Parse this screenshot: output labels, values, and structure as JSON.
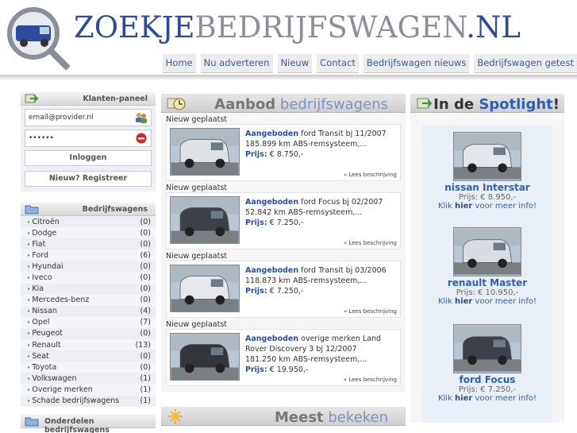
{
  "header": {
    "logo": {
      "part1": "ZOEKJE",
      "part2": "BEDRIJFSWAGEN",
      "part3": ".NL"
    },
    "nav": [
      "Home",
      "Nu adverteren",
      "Nieuw",
      "Contact",
      "Bedrijfswagen nieuws",
      "Bedrijfswagen getest"
    ]
  },
  "login": {
    "title": "Klanten-paneel",
    "email_value": "email@provider.nl",
    "password_value": "••••••",
    "login_button": "Inloggen",
    "register_button": "Nieuw? Registreer"
  },
  "brands": {
    "title": "Bedrijfswagens",
    "items": [
      {
        "name": "Citroën",
        "count": "(0)"
      },
      {
        "name": "Dodge",
        "count": "(0)"
      },
      {
        "name": "Fiat",
        "count": "(0)"
      },
      {
        "name": "Ford",
        "count": "(6)"
      },
      {
        "name": "Hyundai",
        "count": "(0)"
      },
      {
        "name": "Iveco",
        "count": "(0)"
      },
      {
        "name": "Kia",
        "count": "(0)"
      },
      {
        "name": "Mercedes-benz",
        "count": "(0)"
      },
      {
        "name": "Nissan",
        "count": "(4)"
      },
      {
        "name": "Opel",
        "count": "(7)"
      },
      {
        "name": "Peugeot",
        "count": "(0)"
      },
      {
        "name": "Renault",
        "count": "(13)"
      },
      {
        "name": "Seat",
        "count": "(0)"
      },
      {
        "name": "Toyota",
        "count": "(0)"
      },
      {
        "name": "Volkswagen",
        "count": "(1)"
      },
      {
        "name": "Overige merken",
        "count": "(1)"
      },
      {
        "name": "Schade bedrijfswagens",
        "count": "(1)"
      }
    ],
    "next_title": "Onderdelen bedrijfswagens"
  },
  "aanbod": {
    "title_bold": "Aanbod",
    "title_rest": " bedrijfswagens",
    "listings": [
      {
        "label": "Nieuw geplaatst",
        "tag": "Aangeboden",
        "desc": " ford Transit bj 11/2007",
        "line2": "185.899 km ABS-remsysteem,...",
        "prijs_label": "Prijs:",
        "prijs": " € 8.750,-",
        "lees": "» Lees beschrijving",
        "color": "#dfe3e8"
      },
      {
        "label": "Nieuw geplaatst",
        "tag": "Aangeboden",
        "desc": " ford Focus bj 02/2007",
        "line2": "52.842 km ABS-remsysteem,...",
        "prijs_label": "Prijs:",
        "prijs": " € 7.250,-",
        "lees": "» Lees beschrijving",
        "color": "#3c4048"
      },
      {
        "label": "Nieuw geplaatst",
        "tag": "Aangeboden",
        "desc": " ford Transit bj 03/2006",
        "line2": "118.873 km ABS-remsysteem,...",
        "prijs_label": "Prijs:",
        "prijs": " € 7.250,-",
        "lees": "» Lees beschrijving",
        "color": "#e6e8ec"
      },
      {
        "label": "Nieuw geplaatst",
        "tag": "Aangeboden",
        "desc": " overige merken Land Rover Discovery 3 bj 12/2007",
        "line2": "181.250 km ABS-remsysteem,...",
        "prijs_label": "Prijs:",
        "prijs": " € 19.950,-",
        "lees": "» Lees beschrijving",
        "color": "#33363a"
      }
    ]
  },
  "meest": {
    "title_bold": "Meest",
    "title_rest": " bekeken"
  },
  "spotlight": {
    "title_pre": "In de ",
    "title_spot": "Spotlight",
    "title_post": "!",
    "items": [
      {
        "name": "nissan Interstar",
        "price": "Prijs: € 8.950,-",
        "more_pre": "Klik ",
        "more_hier": "hier",
        "more_post": " voor meer info!",
        "color": "#e3e6ea"
      },
      {
        "name": "renault Master",
        "price": "Prijs: € 10.950,-",
        "more_pre": "Klik ",
        "more_hier": "hier",
        "more_post": " voor meer info!",
        "color": "#d9dde3"
      },
      {
        "name": "ford Focus",
        "price": "Prijs: € 7.250,-",
        "more_pre": "Klik ",
        "more_hier": "hier",
        "more_post": " voor meer info!",
        "color": "#3c4048"
      }
    ]
  }
}
